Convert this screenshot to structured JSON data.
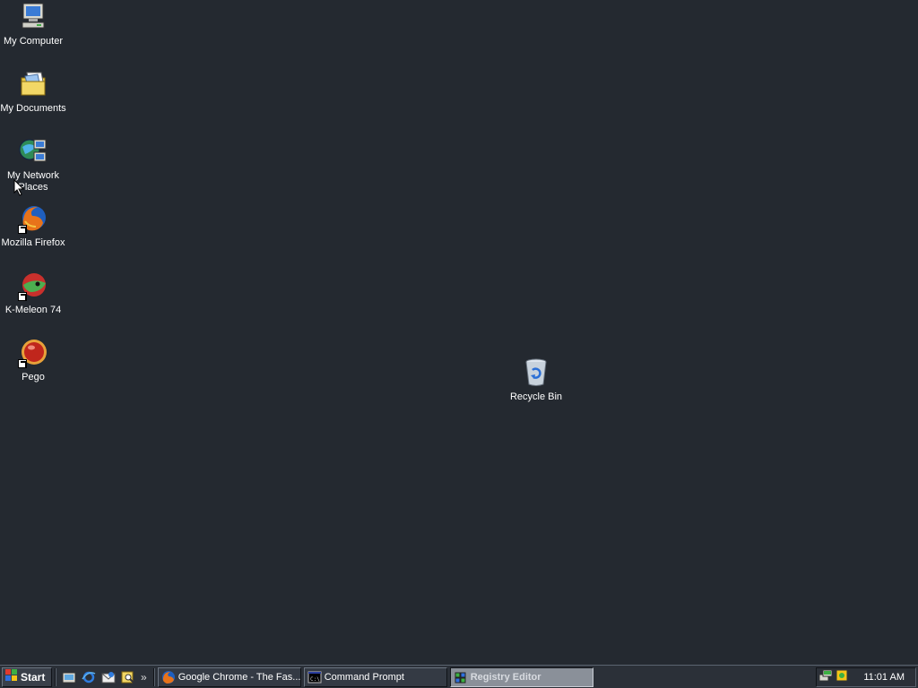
{
  "desktop": {
    "background": "#242930",
    "icons": [
      {
        "id": "my-computer",
        "label": "My Computer"
      },
      {
        "id": "my-documents",
        "label": "My Documents"
      },
      {
        "id": "my-network-places",
        "label": "My Network Places"
      },
      {
        "id": "mozilla-firefox",
        "label": "Mozilla Firefox"
      },
      {
        "id": "k-meleon",
        "label": "K-Meleon 74"
      },
      {
        "id": "pego",
        "label": "Pego"
      },
      {
        "id": "recycle-bin",
        "label": "Recycle Bin"
      }
    ]
  },
  "taskbar": {
    "start_label": "Start",
    "quick_launch": [
      "show-desktop-icon",
      "internet-explorer-icon",
      "outlook-express-icon",
      "search-icon"
    ],
    "chevron": "»",
    "tasks": [
      {
        "label": "Google Chrome - The Fas...",
        "icon": "firefox-icon",
        "active": false
      },
      {
        "label": "Command Prompt",
        "icon": "command-prompt-icon",
        "active": false
      },
      {
        "label": "Registry Editor",
        "icon": "registry-editor-icon",
        "active": true
      }
    ],
    "tray_icons": [
      "network-icon",
      "security-icon"
    ],
    "clock": "11:01 AM"
  }
}
